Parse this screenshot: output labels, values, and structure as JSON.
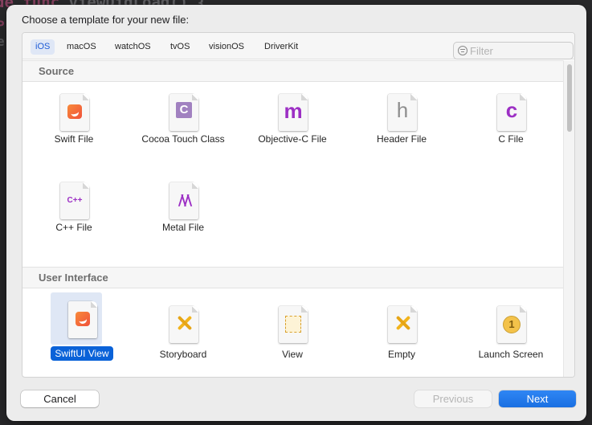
{
  "background": {
    "code_text": "de func viewDidLoad() {",
    "keyword": "de func",
    "fn": "viewDidLoad() {",
    "edge_glyphs": [
      "P",
      "e"
    ]
  },
  "dialog": {
    "title": "Choose a template for your new file:",
    "platform_tabs": [
      {
        "label": "iOS",
        "active": true
      },
      {
        "label": "macOS",
        "active": false
      },
      {
        "label": "watchOS",
        "active": false
      },
      {
        "label": "tvOS",
        "active": false
      },
      {
        "label": "visionOS",
        "active": false
      },
      {
        "label": "DriverKit",
        "active": false
      }
    ],
    "filter": {
      "placeholder": "Filter",
      "value": ""
    },
    "sections": [
      {
        "title": "Source",
        "templates": [
          {
            "label": "Swift File",
            "icon": "swift-file-icon"
          },
          {
            "label": "Cocoa Touch Class",
            "icon": "cocoa-touch-class-icon",
            "glyph": "C"
          },
          {
            "label": "Objective-C File",
            "icon": "objective-c-file-icon",
            "glyph": "m"
          },
          {
            "label": "Header File",
            "icon": "header-file-icon",
            "glyph": "h"
          },
          {
            "label": "C File",
            "icon": "c-file-icon",
            "glyph": "c"
          },
          {
            "label": "C++ File",
            "icon": "cpp-file-icon",
            "glyph": "C++"
          },
          {
            "label": "Metal File",
            "icon": "metal-file-icon"
          }
        ]
      },
      {
        "title": "User Interface",
        "templates": [
          {
            "label": "SwiftUI View",
            "icon": "swiftui-view-icon",
            "selected": true
          },
          {
            "label": "Storyboard",
            "icon": "storyboard-icon"
          },
          {
            "label": "View",
            "icon": "view-icon"
          },
          {
            "label": "Empty",
            "icon": "empty-icon"
          },
          {
            "label": "Launch Screen",
            "icon": "launch-screen-icon",
            "glyph": "1"
          }
        ]
      }
    ],
    "buttons": {
      "cancel": "Cancel",
      "previous": "Previous",
      "next": "Next"
    }
  },
  "colors": {
    "accent": "#0a62d8",
    "swift": "#f0513a",
    "objc_purple": "#9c2fc4",
    "ib_yellow": "#f2b41d",
    "header_gray": "#8e8e8e"
  }
}
